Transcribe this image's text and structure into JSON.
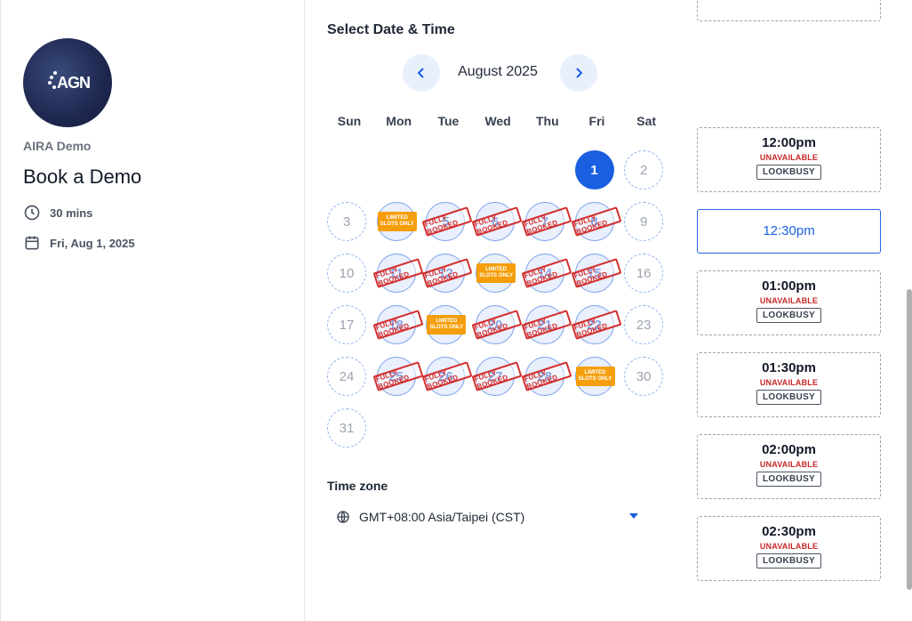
{
  "profile": {
    "logo_text": "AGN",
    "org_name": "AIRA Demo",
    "event_title": "Book a Demo",
    "duration": "30 mins",
    "selected_date": "Fri, Aug 1, 2025"
  },
  "calendar": {
    "section_title": "Select Date & Time",
    "month_label": "August 2025",
    "weekdays": [
      "Sun",
      "Mon",
      "Tue",
      "Wed",
      "Thu",
      "Fri",
      "Sat"
    ],
    "days": [
      {
        "d": "1",
        "col": 5,
        "row": 0,
        "state": "selected"
      },
      {
        "d": "2",
        "col": 6,
        "row": 0,
        "state": "disabled"
      },
      {
        "d": "3",
        "col": 0,
        "row": 1,
        "state": "disabled"
      },
      {
        "d": "4",
        "col": 1,
        "row": 1,
        "state": "limited"
      },
      {
        "d": "5",
        "col": 2,
        "row": 1,
        "state": "booked"
      },
      {
        "d": "6",
        "col": 3,
        "row": 1,
        "state": "booked"
      },
      {
        "d": "7",
        "col": 4,
        "row": 1,
        "state": "booked"
      },
      {
        "d": "8",
        "col": 5,
        "row": 1,
        "state": "booked"
      },
      {
        "d": "9",
        "col": 6,
        "row": 1,
        "state": "disabled"
      },
      {
        "d": "10",
        "col": 0,
        "row": 2,
        "state": "disabled"
      },
      {
        "d": "11",
        "col": 1,
        "row": 2,
        "state": "booked"
      },
      {
        "d": "12",
        "col": 2,
        "row": 2,
        "state": "booked"
      },
      {
        "d": "13",
        "col": 3,
        "row": 2,
        "state": "limited"
      },
      {
        "d": "14",
        "col": 4,
        "row": 2,
        "state": "booked"
      },
      {
        "d": "15",
        "col": 5,
        "row": 2,
        "state": "booked"
      },
      {
        "d": "16",
        "col": 6,
        "row": 2,
        "state": "disabled"
      },
      {
        "d": "17",
        "col": 0,
        "row": 3,
        "state": "disabled"
      },
      {
        "d": "18",
        "col": 1,
        "row": 3,
        "state": "booked"
      },
      {
        "d": "19",
        "col": 2,
        "row": 3,
        "state": "limited"
      },
      {
        "d": "20",
        "col": 3,
        "row": 3,
        "state": "booked"
      },
      {
        "d": "21",
        "col": 4,
        "row": 3,
        "state": "booked"
      },
      {
        "d": "22",
        "col": 5,
        "row": 3,
        "state": "booked"
      },
      {
        "d": "23",
        "col": 6,
        "row": 3,
        "state": "disabled"
      },
      {
        "d": "24",
        "col": 0,
        "row": 4,
        "state": "disabled"
      },
      {
        "d": "25",
        "col": 1,
        "row": 4,
        "state": "booked"
      },
      {
        "d": "26",
        "col": 2,
        "row": 4,
        "state": "booked"
      },
      {
        "d": "27",
        "col": 3,
        "row": 4,
        "state": "booked"
      },
      {
        "d": "28",
        "col": 4,
        "row": 4,
        "state": "booked"
      },
      {
        "d": "29",
        "col": 5,
        "row": 4,
        "state": "limited"
      },
      {
        "d": "30",
        "col": 6,
        "row": 4,
        "state": "disabled"
      },
      {
        "d": "31",
        "col": 0,
        "row": 5,
        "state": "disabled"
      }
    ],
    "stamp_full_text": "FULLY BOOKED",
    "stamp_limited_line1": "LIMITED",
    "stamp_limited_line2": "SLOTS ONLY"
  },
  "timezone": {
    "label": "Time zone",
    "value": "GMT+08:00 Asia/Taipei (CST)"
  },
  "slots": [
    {
      "time": "",
      "status": "partial",
      "unavailable_text": "",
      "busy_text": ""
    },
    {
      "time": "12:00pm",
      "status": "unavailable",
      "unavailable_text": "UNAVAILABLE",
      "busy_text": "LOOKBUSY"
    },
    {
      "time": "12:30pm",
      "status": "available",
      "unavailable_text": "",
      "busy_text": ""
    },
    {
      "time": "01:00pm",
      "status": "unavailable",
      "unavailable_text": "UNAVAILABLE",
      "busy_text": "LOOKBUSY"
    },
    {
      "time": "01:30pm",
      "status": "unavailable",
      "unavailable_text": "UNAVAILABLE",
      "busy_text": "LOOKBUSY"
    },
    {
      "time": "02:00pm",
      "status": "unavailable",
      "unavailable_text": "UNAVAILABLE",
      "busy_text": "LOOKBUSY"
    },
    {
      "time": "02:30pm",
      "status": "unavailable",
      "unavailable_text": "UNAVAILABLE",
      "busy_text": "LOOKBUSY"
    }
  ],
  "colors": {
    "accent": "#1a5fe0",
    "booked_stamp": "#d32f2f",
    "limited_stamp": "#f59e0b",
    "unavailable": "#c62828"
  }
}
